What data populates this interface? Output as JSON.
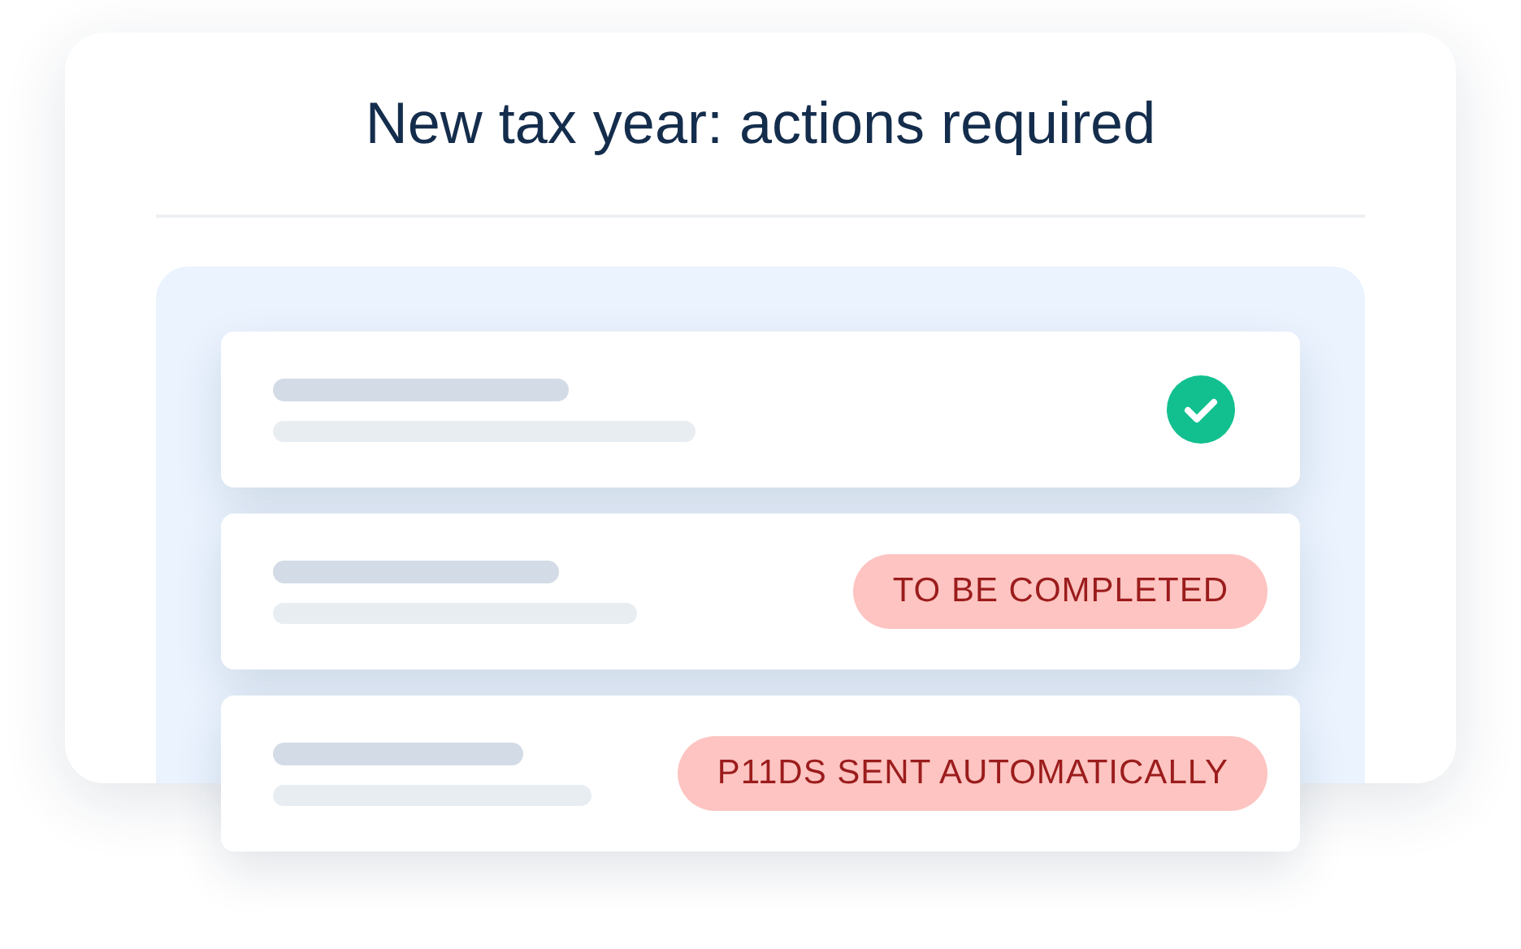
{
  "title": "New tax year: actions required",
  "tasks": [
    {
      "kind": "done"
    },
    {
      "kind": "badge",
      "label": "TO BE COMPLETED"
    },
    {
      "kind": "badge",
      "label": "P11DS SENT AUTOMATICALLY"
    }
  ]
}
